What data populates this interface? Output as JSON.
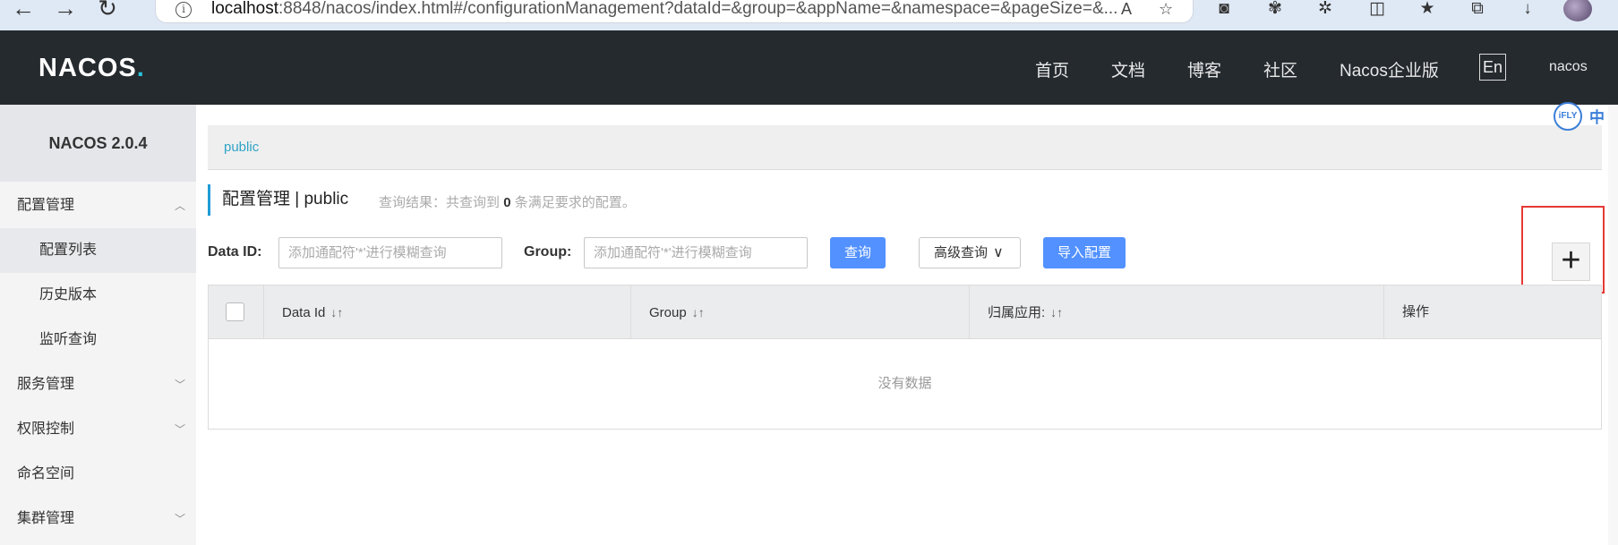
{
  "browser": {
    "url_host": "localhost",
    "url_rest": ":8848/nacos/index.html#/configurationManagement?dataId=&group=&appName=&namespace=&pageSize=&..."
  },
  "header": {
    "logo": "NACOS",
    "logo_dot": ".",
    "nav": [
      "首页",
      "文档",
      "博客",
      "社区",
      "Nacos企业版"
    ],
    "lang": "En",
    "user": "nacos"
  },
  "sidebar": {
    "version": "NACOS 2.0.4",
    "items": [
      {
        "label": "配置管理"
      },
      {
        "label": "配置列表"
      },
      {
        "label": "历史版本"
      },
      {
        "label": "监听查询"
      },
      {
        "label": "服务管理"
      },
      {
        "label": "权限控制"
      },
      {
        "label": "命名空间"
      },
      {
        "label": "集群管理"
      }
    ]
  },
  "main": {
    "namespace": "public",
    "title": "配置管理  |  public",
    "hint_prefix": "查询结果：共查询到",
    "hint_count": "0",
    "hint_suffix": "条满足要求的配置。",
    "filters": {
      "dataid_label": "Data ID:",
      "dataid_placeholder": "添加通配符'*'进行模糊查询",
      "group_label": "Group:",
      "group_placeholder": "添加通配符'*'进行模糊查询",
      "query_button": "查询",
      "advanced_button": "高级查询",
      "import_button": "导入配置",
      "add_button": "+"
    },
    "table": {
      "columns": [
        "Data Id",
        "Group",
        "归属应用:",
        "操作"
      ],
      "empty_text": "没有数据"
    }
  },
  "ifly": {
    "badge": "iFLY",
    "lang": "中"
  }
}
